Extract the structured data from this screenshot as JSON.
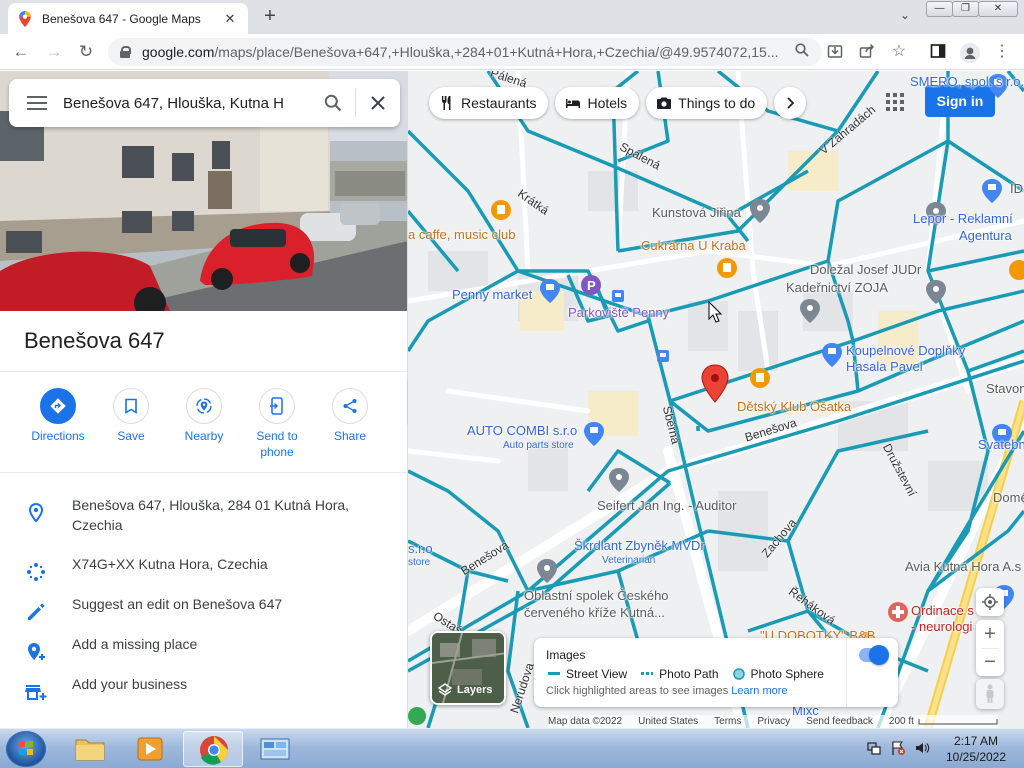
{
  "browser": {
    "tab_title": "Benešova 647 - Google Maps",
    "url_host": "google.com",
    "url_path": "/maps/place/Benešova+647,+Hlouška,+284+01+Kutná+Hora,+Czechia/@49.9574072,15...",
    "window_buttons": [
      "minimize",
      "maximize",
      "close"
    ]
  },
  "search": {
    "value": "Benešova 647, Hlouška, Kutna H"
  },
  "place": {
    "title": "Benešova 647",
    "actions": [
      {
        "label": "Directions",
        "icon": "directions-icon"
      },
      {
        "label": "Save",
        "icon": "bookmark-icon"
      },
      {
        "label": "Nearby",
        "icon": "nearby-icon"
      },
      {
        "label": "Send to phone",
        "icon": "phone-icon"
      },
      {
        "label": "Share",
        "icon": "share-icon"
      }
    ],
    "address": "Benešova 647, Hlouška, 284 01 Kutná Hora, Czechia",
    "plus_code": "X74G+XX Kutna Hora, Czechia",
    "suggest_edit": "Suggest an edit on Benešova 647",
    "add_place": "Add a missing place",
    "add_business": "Add your business"
  },
  "map": {
    "chips": [
      "Restaurants",
      "Hotels",
      "Things to do"
    ],
    "sign_in": "Sign in",
    "labels": {
      "smero": "SMERO, spol. s r.o.",
      "kunstova": "Kunstová Jiřina",
      "caffe": "a caffe, music club",
      "kabra": "Cukrárna U Kraba",
      "lepor": "Lepor - Reklamní",
      "lepor2": "Agentura",
      "doleza": "Doležal Josef JUDr",
      "zoja": "Kadeřnictví ZOJA",
      "penny_market": "Penny market",
      "parkoviste": "Parkoviště Penny",
      "koupelnove": "Koupelnové Doplňky",
      "hasala": "Hasala Pavel",
      "detsky": "Dětský Klub Ošatka",
      "autocombi": "AUTO COMBI s.r.o",
      "autocombi_sub": "Auto parts store",
      "stavone": "Stavone",
      "svatebni": "Svatební stu",
      "seifert": "Seifert Jan Ing. - Auditor",
      "domexim": "Domexim",
      "skrdlant": "Škrdlant Zbyněk MVDr",
      "skrdlant_sub": "Veterinarian",
      "avia": "Avia Kutná Hora A.s",
      "oblastni1": "Oblastní spolek Českého",
      "oblastni2": "červeného kříže Kutná...",
      "ordinace": "Ordinace s",
      "ordinace2": "- neurologi",
      "dobotky": "\"U DOBOTKY\" B&B",
      "idi": "IDI",
      "sro": "s.r.o",
      "store": "store",
      "mixc": "Mixc"
    },
    "streets": {
      "spalena": "Spálená",
      "kratka": "Krátká",
      "vzahradach": "V Zahradách",
      "benesova1": "Benešova",
      "benesova2": "Benešova",
      "sberna": "Sběrná",
      "druzstevni": "Družstevní",
      "zachova": "Zachova",
      "rehakova": "Řeháková",
      "nerudova": "Nerudova",
      "ostas": "Ostaš",
      "palenia": "Pálená"
    },
    "layers_label": "Layers",
    "streetview": {
      "title": "Images",
      "street_view": "Street View",
      "photo_path": "Photo Path",
      "photo_sphere": "Photo Sphere",
      "help": "Click highlighted areas to see images",
      "learn_more": "Learn more",
      "enabled": true
    },
    "footer": {
      "data": "Map data ©2022",
      "country": "United States",
      "terms": "Terms",
      "privacy": "Privacy",
      "feedback": "Send feedback",
      "scale": "200 ft"
    },
    "colors": {
      "coverage": "#1a9bb5",
      "pin": "#ea4335",
      "accent": "#1a73e8"
    }
  },
  "taskbar": {
    "time": "2:17 AM",
    "date": "10/25/2022"
  }
}
